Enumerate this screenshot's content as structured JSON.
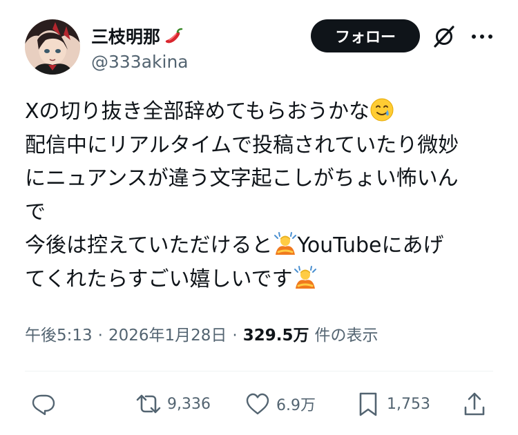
{
  "user": {
    "display_name": "三枝明那",
    "name_emoji": "hot-pepper-emoji",
    "handle": "@333akina"
  },
  "header": {
    "follow_label": "フォロー",
    "grok_icon": "grok-icon",
    "more_icon": "more-icon"
  },
  "tweet": {
    "lines": [
      "Xの切り抜き全部辞めてもらおうかな",
      "配信中にリアルタイムで投稿されていたり微妙",
      "にニュアンスが違う文字起こしがちょい怖いん",
      "で",
      "今後は控えていただけると",
      "YouTubeにあげ",
      "てくれたらすごい嬉しいです"
    ],
    "emojis": {
      "line1_end": "tear-smile-emoji",
      "line5_mid": "bowing-person-emoji",
      "line6_end": "bowing-person-emoji"
    }
  },
  "meta": {
    "time": "午後5:13",
    "separator": "·",
    "date": "2026年1月28日",
    "views_count": "329.5万",
    "views_label": "件の表示"
  },
  "actions": {
    "reply_icon": "reply-icon",
    "retweet_count": "9,336",
    "like_count": "6.9万",
    "bookmark_count": "1,753",
    "share_icon": "share-icon"
  },
  "colors": {
    "text": "#0f1419",
    "secondary": "#536471",
    "button_bg": "#0f1419",
    "divider": "#eff3f4"
  }
}
